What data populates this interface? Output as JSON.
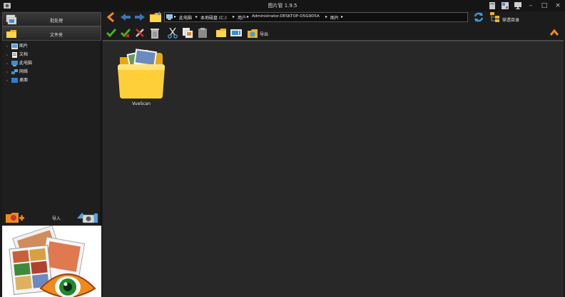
{
  "window": {
    "title": "图片管 1.9.5",
    "controls": [
      "–",
      "□",
      "×"
    ]
  },
  "sidebar": {
    "batch_label": "批处理",
    "folder_label": "文件夹",
    "tree": [
      {
        "label": "图片",
        "icon": "pictures-icon"
      },
      {
        "label": "文档",
        "icon": "documents-icon"
      },
      {
        "label": "此电脑",
        "icon": "computer-icon"
      },
      {
        "label": "网络",
        "icon": "network-icon"
      },
      {
        "label": "桌面",
        "icon": "desktop-icon"
      }
    ],
    "import_label": "导入"
  },
  "toolbar": {
    "path": [
      "此电脑",
      "本地磁盘 (C:)",
      "用户",
      "Administrator.DESKTOP-O5G9D5A",
      "图片"
    ],
    "through_label": "穿透目录",
    "export_label": "导出"
  },
  "content": {
    "items": [
      {
        "name": "VueScan",
        "icon": "folder-icon"
      }
    ]
  },
  "colors": {
    "background": "#282828",
    "sidebar": "#1e1e1e",
    "accent_orange": "#f08a1c",
    "check_green": "#46b41e",
    "arrow_blue": "#3aa0e0"
  }
}
